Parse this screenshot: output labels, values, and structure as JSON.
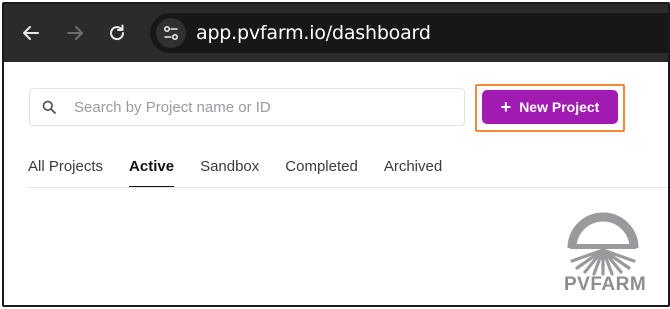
{
  "browser": {
    "url": "app.pvfarm.io/dashboard"
  },
  "search": {
    "placeholder": "Search by Project name or ID"
  },
  "toolbar": {
    "new_project_plus": "+",
    "new_project_label": "New Project"
  },
  "tabs": [
    {
      "label": "All Projects",
      "active": false
    },
    {
      "label": "Active",
      "active": true
    },
    {
      "label": "Sandbox",
      "active": false
    },
    {
      "label": "Completed",
      "active": false
    },
    {
      "label": "Archived",
      "active": false
    }
  ],
  "brand": {
    "name": "PVFARM"
  },
  "colors": {
    "accent": "#a11bb3",
    "highlight_border": "#f4893b",
    "browser_bar": "#2b2b2d"
  },
  "icons": [
    "back-arrow-icon",
    "forward-arrow-icon",
    "reload-icon",
    "site-settings-icon",
    "search-icon",
    "pvfarm-logo"
  ]
}
